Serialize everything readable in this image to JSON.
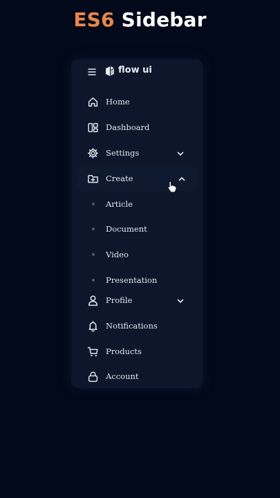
{
  "page": {
    "title_accent": "ES6",
    "title_rest": " Sidebar"
  },
  "sidebar": {
    "brand": "flow ui",
    "items": [
      {
        "label": "Home",
        "icon": "home-icon"
      },
      {
        "label": "Dashboard",
        "icon": "dashboard-icon"
      },
      {
        "label": "Settings",
        "icon": "gear-icon",
        "expandable": true,
        "expanded": false
      },
      {
        "label": "Create",
        "icon": "folder-plus-icon",
        "expandable": true,
        "expanded": true,
        "hovered": true
      },
      {
        "label": "Profile",
        "icon": "user-icon",
        "expandable": true,
        "expanded": false
      },
      {
        "label": "Notifications",
        "icon": "bell-icon"
      },
      {
        "label": "Products",
        "icon": "cart-icon"
      },
      {
        "label": "Account",
        "icon": "lock-icon"
      }
    ],
    "create_submenu": [
      "Article",
      "Document",
      "Video",
      "Presentation"
    ]
  },
  "colors": {
    "background": "#02091a",
    "sidebar": "#0d162b",
    "accent": "#e8864d",
    "text": "#e2e6ee"
  }
}
